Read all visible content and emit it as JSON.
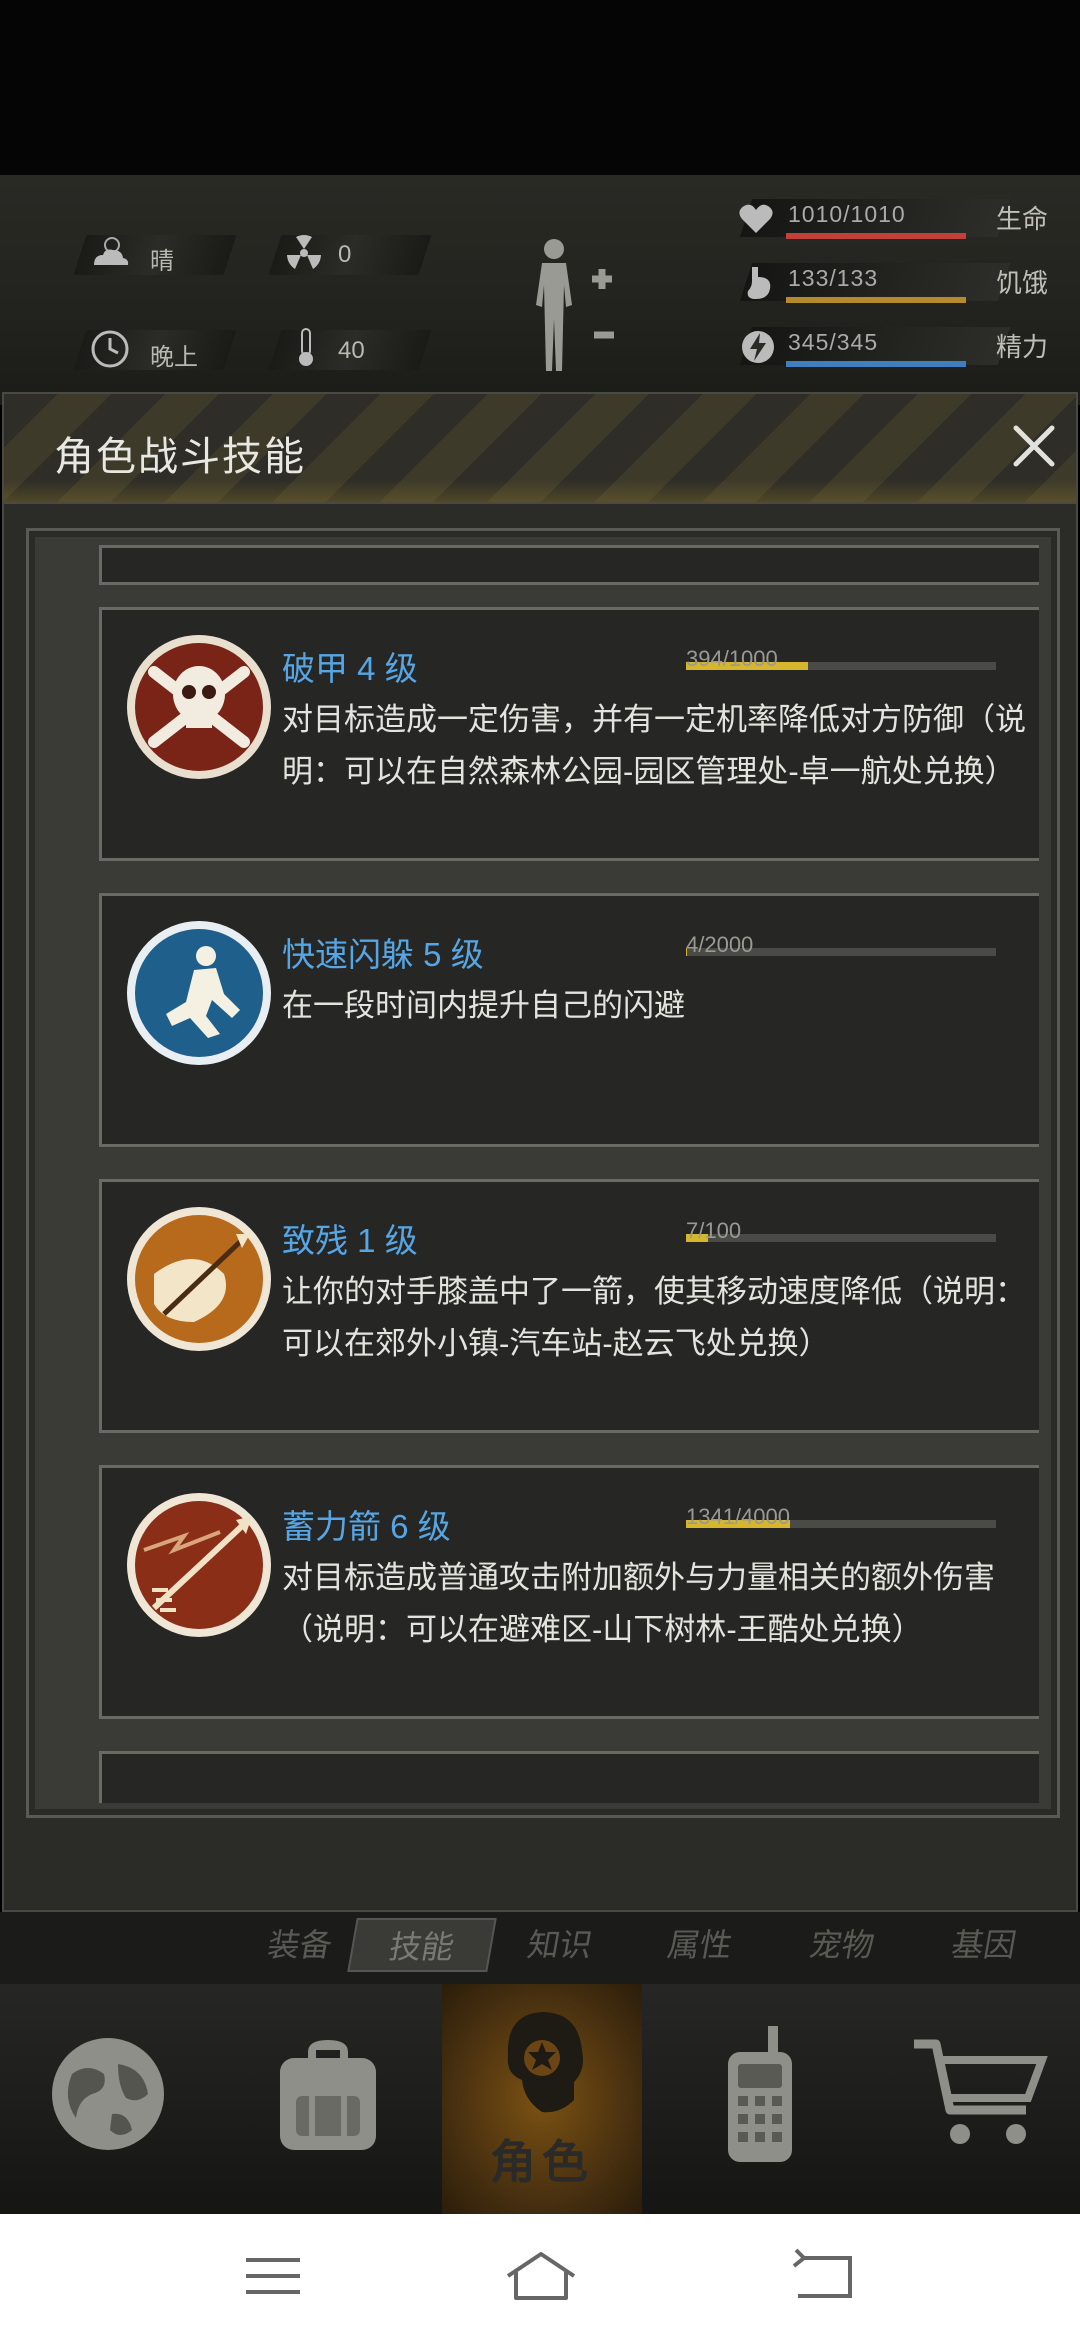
{
  "hud": {
    "weather": "晴",
    "radiation": "0",
    "time_of_day": "晚上",
    "temperature": "40",
    "stats": [
      {
        "name": "生命",
        "value": "1010/1010",
        "color": "#c2403a",
        "fill": 1.0
      },
      {
        "name": "饥饿",
        "value": "133/133",
        "color": "#b48a2a",
        "fill": 1.0
      },
      {
        "name": "精力",
        "value": "345/345",
        "color": "#3f7fc0",
        "fill": 1.0
      }
    ]
  },
  "panel": {
    "title": "角色战斗技能"
  },
  "skills": [
    {
      "name": "破甲 4 级",
      "progress": "394/1000",
      "fill": 0.394,
      "desc": "对目标造成一定伤害，并有一定机率降低对方防御（说明：可以在自然森林公园-园区管理处-卓一航处兑换）",
      "icon": "skull-crossbones-icon"
    },
    {
      "name": "快速闪躲 5 级",
      "progress": "4/2000",
      "fill": 0.002,
      "desc": "在一段时间内提升自己的闪避",
      "icon": "dodge-figure-icon"
    },
    {
      "name": "致残 1 级",
      "progress": "7/100",
      "fill": 0.07,
      "desc": "让你的对手膝盖中了一箭，使其移动速度降低（说明：可以在郊外小镇-汽车站-赵云飞处兑换）",
      "icon": "arrow-in-knee-icon"
    },
    {
      "name": "蓄力箭 6 级",
      "progress": "1341/4000",
      "fill": 0.335,
      "desc": "对目标造成普通攻击附加额外与力量相关的额外伤害（说明：可以在避难区-山下树林-王酷处兑换）",
      "icon": "charged-arrow-icon"
    }
  ],
  "subtabs": [
    "装备",
    "技能",
    "知识",
    "属性",
    "宠物",
    "基因"
  ],
  "active_subtab": "技能",
  "nav": {
    "active_label": "角色",
    "items": [
      "globe-icon",
      "backpack-icon",
      "character-icon",
      "radio-icon",
      "cart-icon"
    ]
  },
  "colors": {
    "skill_name": "#56a6e6",
    "progress_fill": "#d6b62c",
    "accent_active": "#7b5212"
  }
}
